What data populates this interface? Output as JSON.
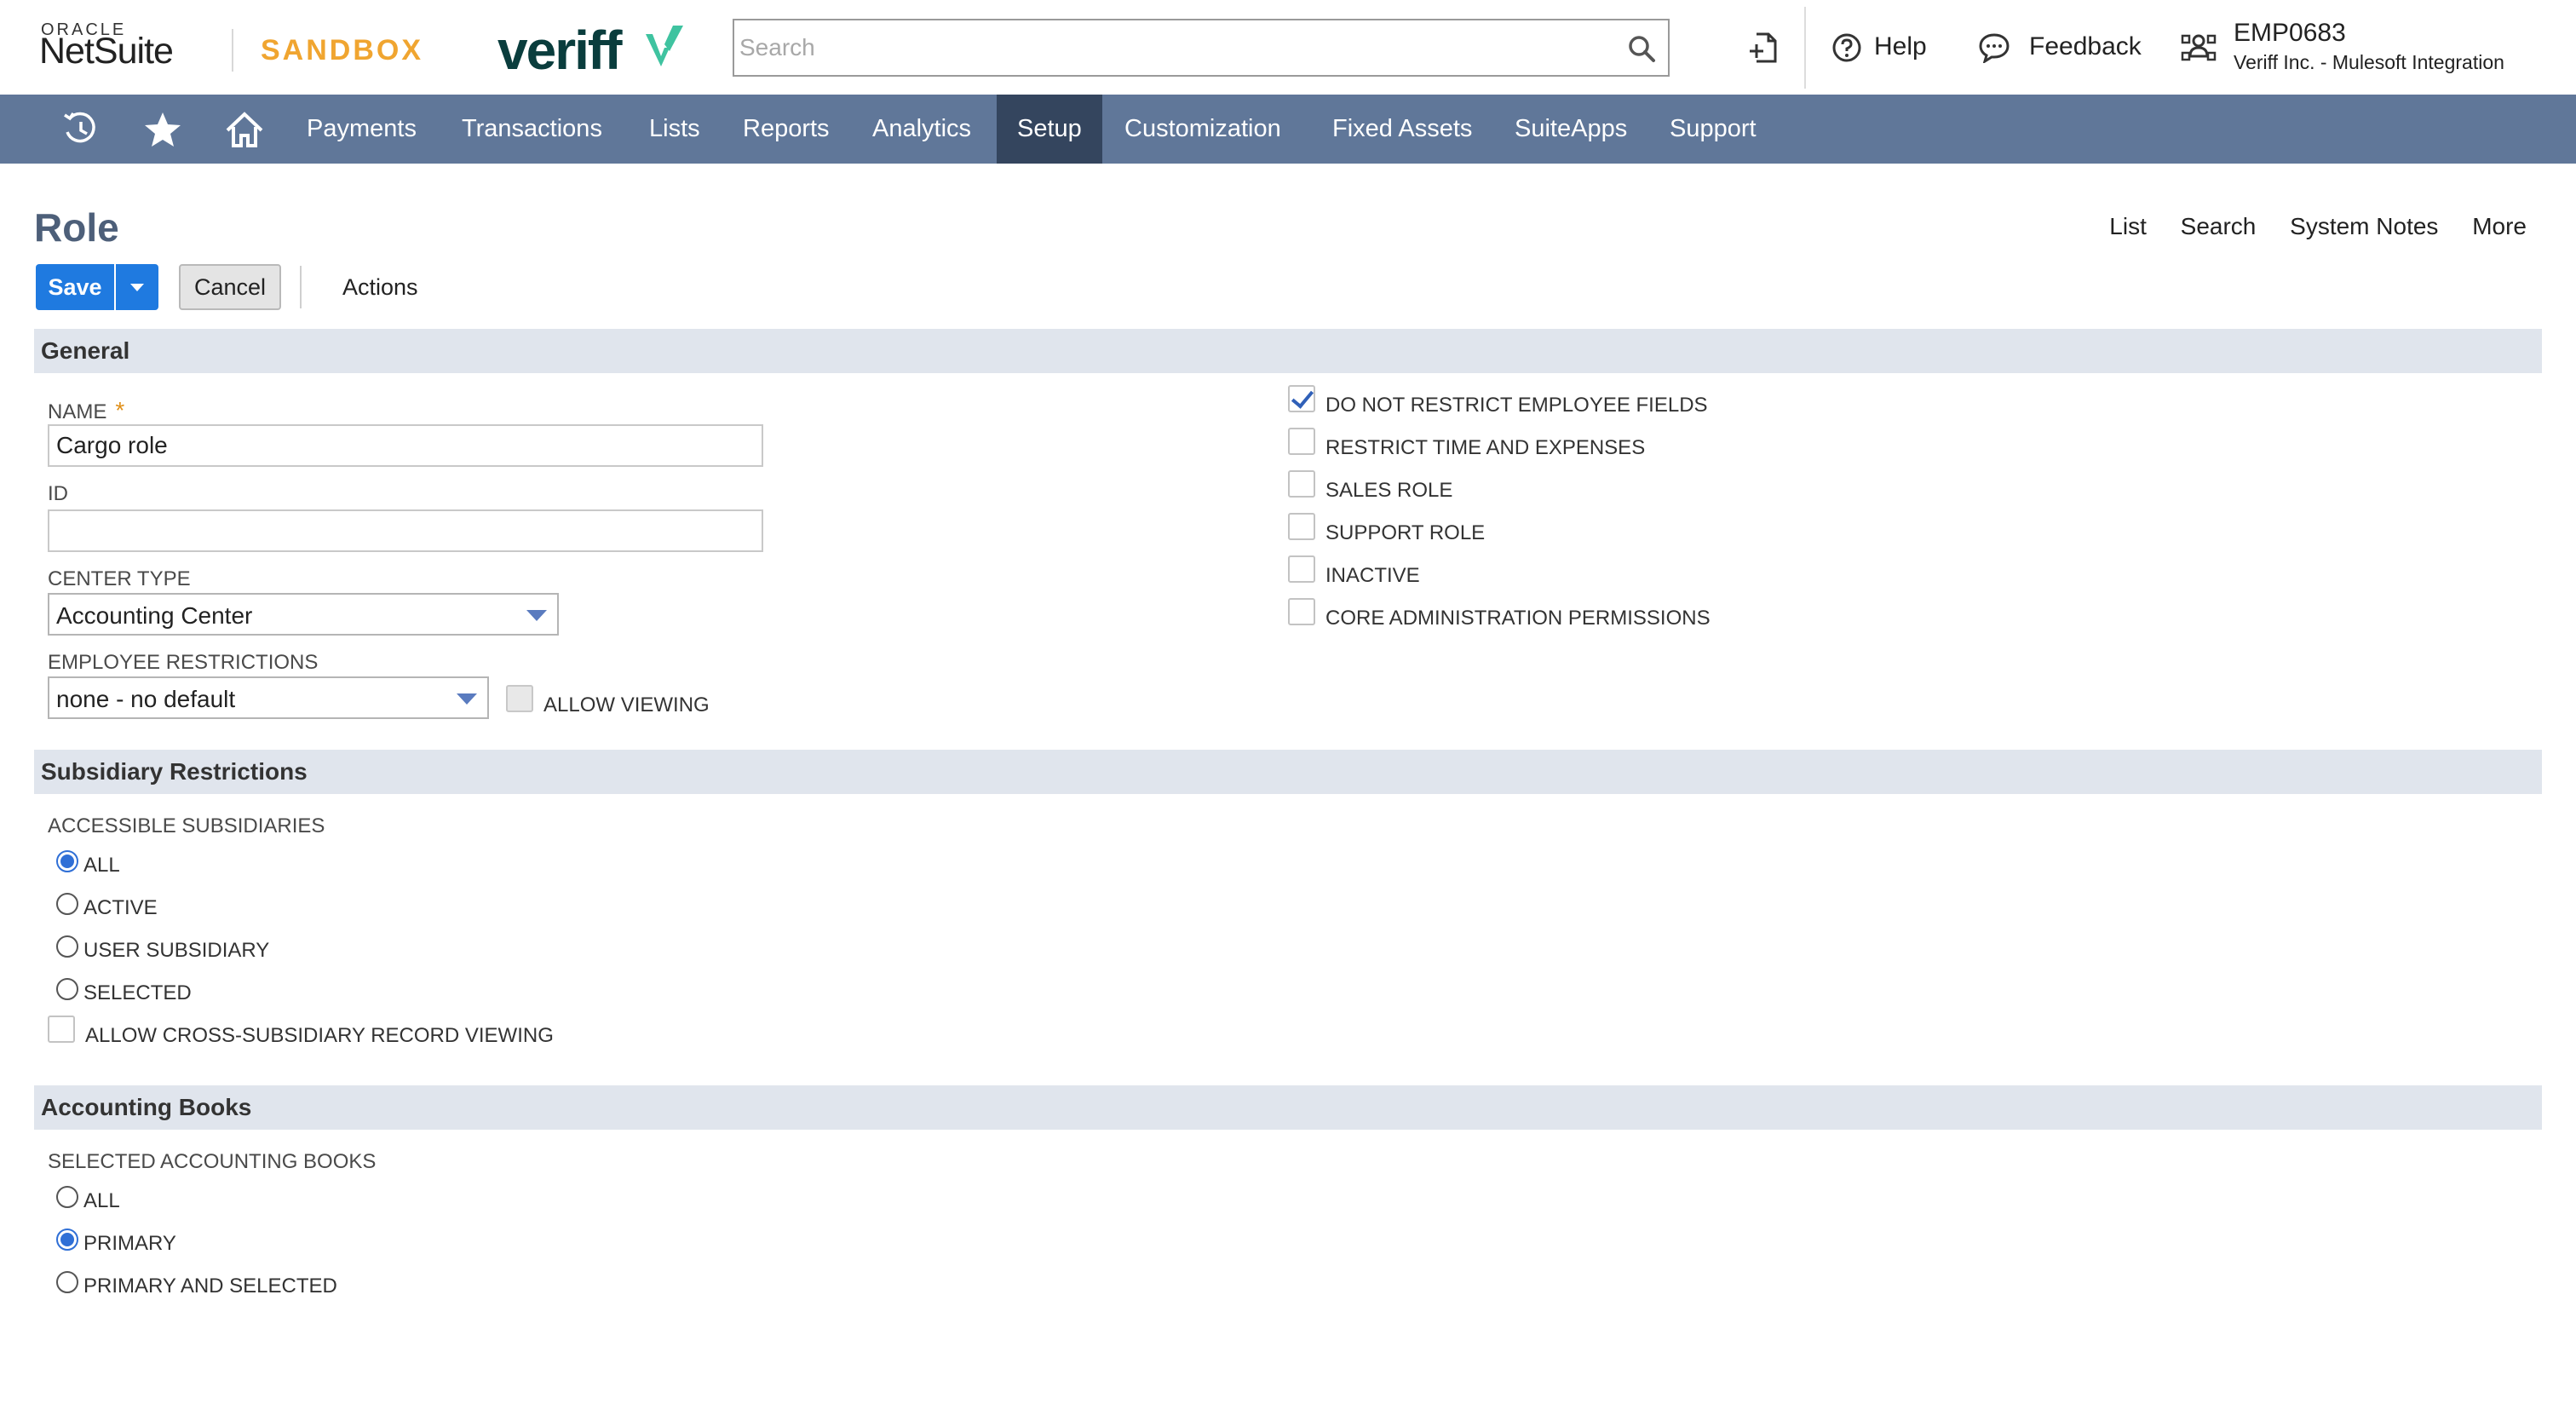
{
  "header": {
    "oracle_text": "ORACLE",
    "netsuite_text": "NetSuite",
    "sandbox_text": "SANDBOX",
    "veriff_text": "veriff",
    "search_placeholder": "Search",
    "help_label": "Help",
    "feedback_label": "Feedback",
    "user_id": "EMP0683",
    "user_org": "Veriff Inc. - Mulesoft Integration",
    "brand_color": "#f0a530",
    "veriff_mark_color": "#3fc3a0"
  },
  "nav": {
    "background": "#607799",
    "active_background": "#34455e",
    "items": [
      {
        "label": "Payments"
      },
      {
        "label": "Transactions"
      },
      {
        "label": "Lists"
      },
      {
        "label": "Reports"
      },
      {
        "label": "Analytics"
      },
      {
        "label": "Setup",
        "active": true
      },
      {
        "label": "Customization"
      },
      {
        "label": "Fixed Assets"
      },
      {
        "label": "SuiteApps"
      },
      {
        "label": "Support"
      }
    ],
    "icons": [
      "recent-history-icon",
      "star-icon",
      "home-icon"
    ]
  },
  "page": {
    "title": "Role",
    "links": {
      "list": "List",
      "search": "Search",
      "system_notes": "System Notes",
      "more": "More"
    },
    "buttons": {
      "save": "Save",
      "cancel": "Cancel",
      "actions": "Actions"
    },
    "accent_color": "#1f7ae0"
  },
  "general": {
    "title": "General",
    "name_label": "NAME",
    "name_required": "*",
    "name_value": "Cargo role",
    "id_label": "ID",
    "id_value": "",
    "center_type_label": "CENTER TYPE",
    "center_type_value": "Accounting Center",
    "employee_restrictions_label": "EMPLOYEE RESTRICTIONS",
    "employee_restrictions_value": "none - no default",
    "allow_viewing_label": "ALLOW VIEWING",
    "checkboxes": [
      {
        "label": "DO NOT RESTRICT EMPLOYEE FIELDS",
        "checked": true
      },
      {
        "label": "RESTRICT TIME AND EXPENSES",
        "checked": false
      },
      {
        "label": "SALES ROLE",
        "checked": false
      },
      {
        "label": "SUPPORT ROLE",
        "checked": false
      },
      {
        "label": "INACTIVE",
        "checked": false
      },
      {
        "label": "CORE ADMINISTRATION PERMISSIONS",
        "checked": false
      }
    ]
  },
  "subsidiary": {
    "title": "Subsidiary Restrictions",
    "label": "ACCESSIBLE SUBSIDIARIES",
    "options": [
      {
        "label": "ALL",
        "checked": true
      },
      {
        "label": "ACTIVE",
        "checked": false
      },
      {
        "label": "USER SUBSIDIARY",
        "checked": false
      },
      {
        "label": "SELECTED",
        "checked": false
      }
    ],
    "cross_label": "ALLOW CROSS-SUBSIDIARY RECORD VIEWING"
  },
  "books": {
    "title": "Accounting Books",
    "label": "SELECTED ACCOUNTING BOOKS",
    "options": [
      {
        "label": "ALL",
        "checked": false
      },
      {
        "label": "PRIMARY",
        "checked": true
      },
      {
        "label": "PRIMARY AND SELECTED",
        "checked": false
      }
    ]
  }
}
